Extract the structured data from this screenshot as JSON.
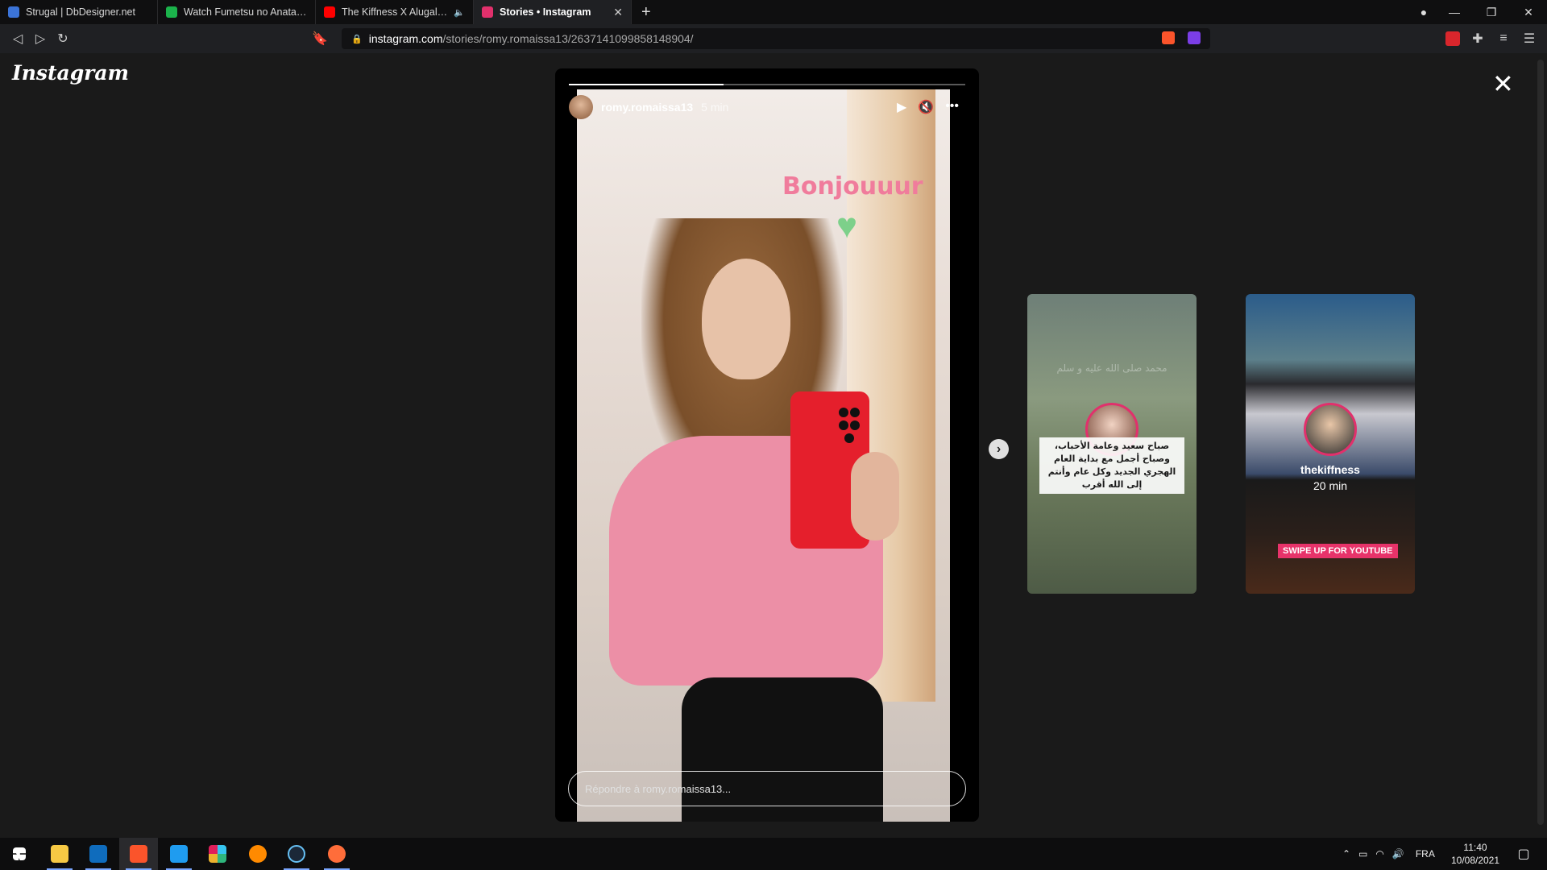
{
  "tabs": [
    {
      "label": "Strugal | DbDesigner.net",
      "favicon_color": "#3b74d8",
      "active": false
    },
    {
      "label": "Watch Fumetsu no Anata e Episode 3",
      "favicon_color": "#1bb34b",
      "active": false
    },
    {
      "label": "The Kiffness X Alugalug Cat 2.0 (Pl",
      "favicon_color": "#ff0000",
      "active": false,
      "audio": "🔈"
    },
    {
      "label": "Stories • Instagram",
      "favicon_color": "#e1306c",
      "active": true,
      "close": "✕"
    }
  ],
  "new_tab": "+",
  "address": {
    "host": "instagram.com",
    "path": "/stories/romy.romaissa13/2637141099858148904/"
  },
  "page": {
    "logo": "Instagram",
    "close": "✕",
    "story": {
      "username": "romy.romaissa13",
      "time": "5 min",
      "progress": 0.39,
      "sticker_text": "Bonjouuur",
      "reply_placeholder": "Répondre à romy.romaissa13..."
    },
    "previews": [
      {
        "text_faint": "محمد صلى الله عليه و سلم",
        "text": "صباح سعيد وعامة الأحباب، وصباح أجمل مع بداية العام الهجري الجديد وكل عام وأنتم إلى الله أقرب",
        "name": "",
        "time": ""
      },
      {
        "name": "thekiffness",
        "time": "20 min",
        "badge": "SWIPE UP FOR YOUTUBE"
      }
    ]
  },
  "taskbar": {
    "language": "FRA",
    "time": "11:40",
    "date": "10/08/2021"
  },
  "colors": {
    "accent": "#e1306c",
    "sticker": "#f07c9c",
    "phone": "#e51f2c"
  }
}
